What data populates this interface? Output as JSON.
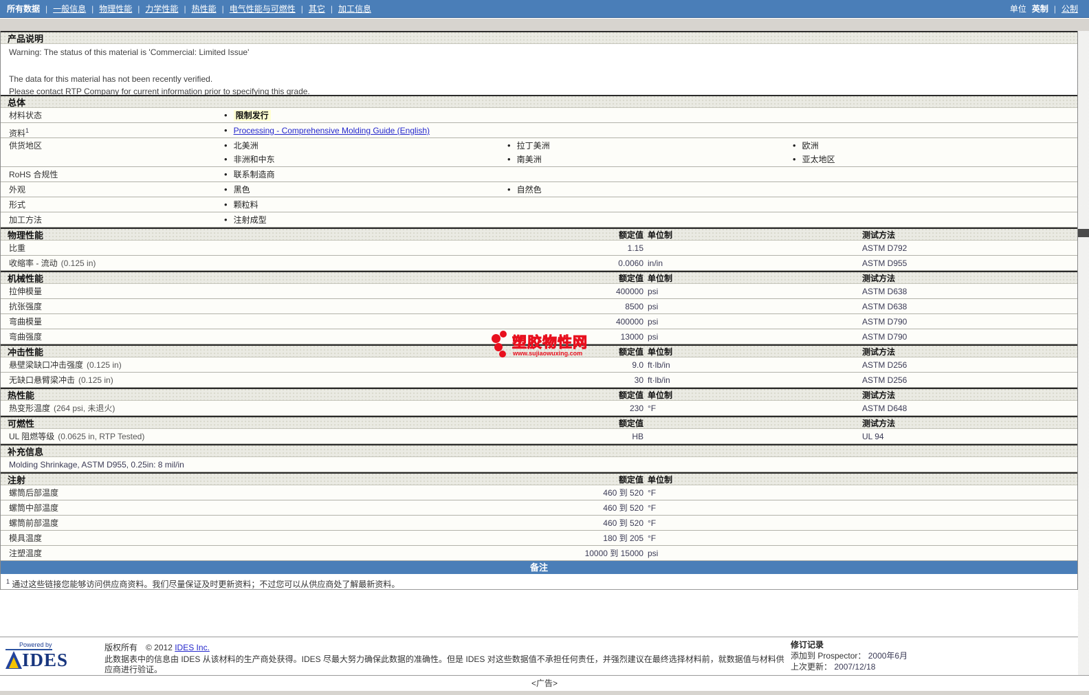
{
  "nav": {
    "current": "所有数据",
    "sep": "|",
    "links": [
      "一般信息",
      "物理性能",
      "力学性能",
      "热性能",
      "电气性能与可燃性",
      "其它",
      "加工信息"
    ],
    "units_label": "单位",
    "unit_current": "英制",
    "unit_alt": "公制"
  },
  "product": {
    "title": "产品说明",
    "warning1": "Warning: The status of this material is 'Commercial: Limited Issue'",
    "warning2": "The data for this material has not been recently verified.",
    "warning3": "Please contact RTP Company for current information prior to specifying this grade."
  },
  "general": {
    "title": "总体",
    "material_status_label": "材料状态",
    "material_status_value": "限制发行",
    "resources_label": "资料",
    "resources_sup": "1",
    "resources_link": "Processing - Comprehensive Molding Guide (English)",
    "availability_label": "供货地区",
    "availability": {
      "c1r1": "北美洲",
      "c2r1": "拉丁美洲",
      "c3r1": "欧洲",
      "c1r2": "非洲和中东",
      "c2r2": "南美洲",
      "c3r2": "亚太地区"
    },
    "rohs_label": "RoHS 合规性",
    "rohs_value": "联系制造商",
    "appearance_label": "外观",
    "appearance_c1": "黑色",
    "appearance_c2": "自然色",
    "forms_label": "形式",
    "forms_value": "颗粒料",
    "processing_label": "加工方法",
    "processing_value": "注射成型"
  },
  "columns": {
    "value": "额定值",
    "unit": "单位制",
    "method": "测试方法"
  },
  "physical": {
    "title": "物理性能",
    "rows": [
      {
        "label": "比重",
        "cond": "",
        "value": "1.15",
        "unit": "",
        "method": "ASTM D792"
      },
      {
        "label": "收缩率 - 流动",
        "cond": "(0.125 in)",
        "value": "0.0060",
        "unit": "in/in",
        "method": "ASTM D955"
      }
    ]
  },
  "mechanical": {
    "title": "机械性能",
    "rows": [
      {
        "label": "拉伸模量",
        "value": "400000",
        "unit": "psi",
        "method": "ASTM D638"
      },
      {
        "label": "抗张强度",
        "value": "8500",
        "unit": "psi",
        "method": "ASTM D638"
      },
      {
        "label": "弯曲模量",
        "value": "400000",
        "unit": "psi",
        "method": "ASTM D790"
      },
      {
        "label": "弯曲强度",
        "value": "13000",
        "unit": "psi",
        "method": "ASTM D790"
      }
    ]
  },
  "impact": {
    "title": "冲击性能",
    "rows": [
      {
        "label": "悬壁梁缺口冲击强度",
        "cond": "(0.125 in)",
        "value": "9.0",
        "unit": "ft·lb/in",
        "method": "ASTM D256"
      },
      {
        "label": "无缺口悬臂梁冲击",
        "cond": "(0.125 in)",
        "value": "30",
        "unit": "ft·lb/in",
        "method": "ASTM D256"
      }
    ]
  },
  "thermal": {
    "title": "热性能",
    "rows": [
      {
        "label": "热变形温度",
        "cond": "(264 psi, 未退火)",
        "value": "230",
        "unit": "°F",
        "method": "ASTM D648"
      }
    ]
  },
  "flammability": {
    "title": "可燃性",
    "rows": [
      {
        "label": "UL 阻燃等级",
        "cond": "(0.0625 in, RTP Tested)",
        "value": "HB",
        "unit": "",
        "method": "UL 94"
      }
    ]
  },
  "supplemental": {
    "title": "补充信息",
    "text": "Molding Shrinkage, ASTM D955, 0.25in: 8 mil/in"
  },
  "injection": {
    "title": "注射",
    "rows": [
      {
        "label": "螺筒后部温度",
        "value": "460 到 520",
        "unit": "°F"
      },
      {
        "label": "螺筒中部温度",
        "value": "460 到 520",
        "unit": "°F"
      },
      {
        "label": "螺筒前部温度",
        "value": "460 到 520",
        "unit": "°F"
      },
      {
        "label": "模具温度",
        "value": "180 到 205",
        "unit": "°F"
      },
      {
        "label": "注塑温度",
        "value": "10000 到 15000",
        "unit": "psi"
      }
    ]
  },
  "notes": {
    "bar": "备注",
    "footnote_sup": "1",
    "footnote": "通过这些链接您能够访问供应商资料。我们尽量保证及时更新资料；不过您可以从供应商处了解最新资料。"
  },
  "watermark": {
    "name": "塑胶物性网",
    "url": "www.sujiaowuxing.com"
  },
  "footer": {
    "powered_by": "Powered by",
    "logo": "IDES",
    "copyright": "版权所有　© 2012",
    "copyright_link": "IDES Inc.",
    "disclaimer": "此数据表中的信息由 IDES 从该材料的生产商处获得。IDES 尽最大努力确保此数据的准确性。但是 IDES 对这些数据值不承担任何责任，并强烈建议在最终选择材料前，就数据值与材料供应商进行验证。",
    "revision_title": "修订记录",
    "added_label": "添加到 Prospector：",
    "added_value": "2000年6月",
    "updated_label": "上次更新：",
    "updated_value": "2007/12/18"
  },
  "ad": {
    "text": "<广告>"
  },
  "colors": {
    "accent": "#4a7eb8",
    "highlight": "#ffffd2",
    "link": "#2326cc",
    "watermark_red": "#e8101e"
  }
}
